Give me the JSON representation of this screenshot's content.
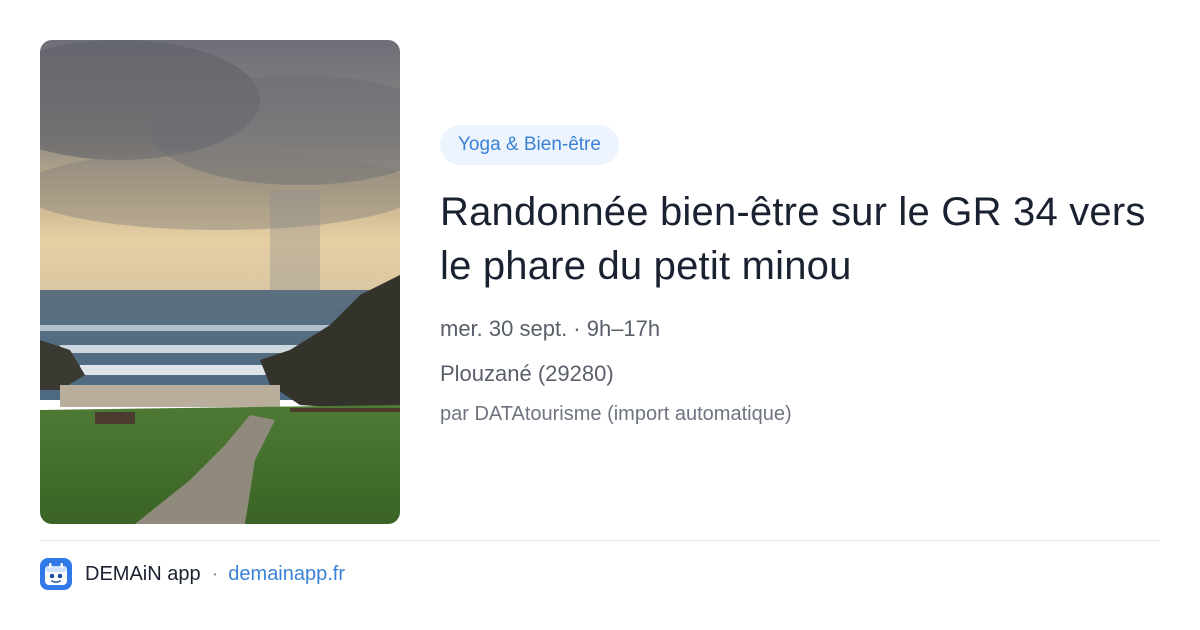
{
  "event": {
    "category": "Yoga & Bien-être",
    "title": "Randonnée bien-être sur le GR 34 vers le phare du petit minou",
    "date_time": "mer. 30 sept. · 9h–17h",
    "location": "Plouzané (29280)",
    "source": "par DATAtourisme (import automatique)",
    "photo": "coastal-path-photo"
  },
  "footer": {
    "app_name": "DEMAiN app",
    "separator": "·",
    "link_text": "demainapp.fr",
    "logo_icon": "demain-app-logo-icon"
  },
  "colors": {
    "accent": "#3b82d6",
    "chip_background": "#edf4fd",
    "title": "#1a2130",
    "meta": "#5a606b",
    "logo": "#2f7ae6"
  }
}
